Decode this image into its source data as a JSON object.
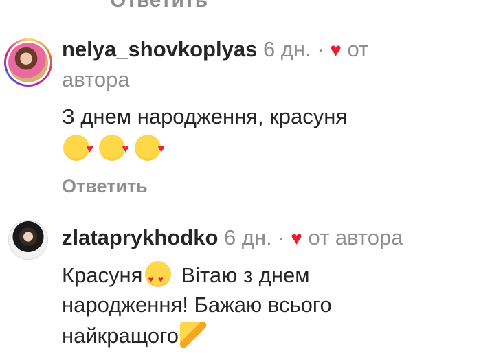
{
  "top_reply": "Ответить",
  "comments": [
    {
      "username": "nelya_shovkoplyas",
      "time": "6 дн.",
      "separator": "·",
      "by_author": "от",
      "by_author_cont": "автора",
      "text_line1": "З днем народження, красуня",
      "emojis": [
        "kissing-heart-face",
        "kissing-heart-face",
        "kissing-heart-face"
      ],
      "reply": "Ответить"
    },
    {
      "username": "zlataprykhodko",
      "time": "6 дн.",
      "separator": "·",
      "by_author": "от автора",
      "text_line1": "Красуня",
      "text_line1b": "Вітаю з днем",
      "text_line2": "народження! Бажаю всього",
      "text_line3": "найкращого",
      "emojis": [
        "heart-eyes-face",
        "party-popper"
      ]
    }
  ],
  "colors": {
    "heart": "#ed1b2f",
    "meta": "#8e8e8e",
    "text": "#262626"
  }
}
